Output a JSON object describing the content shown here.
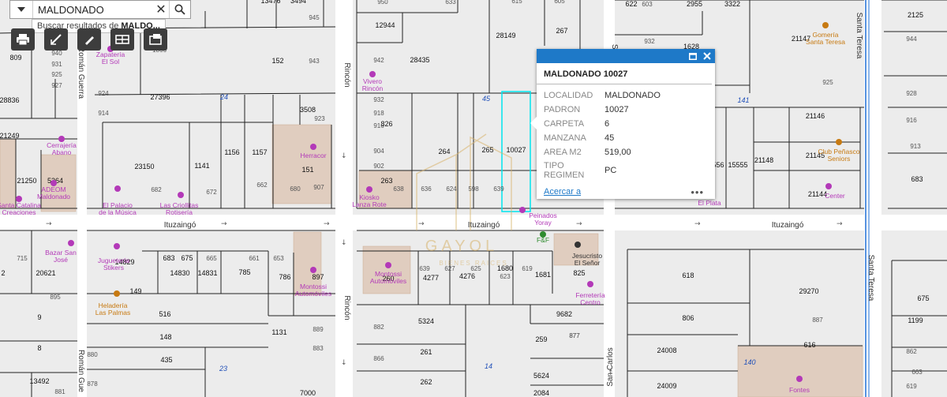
{
  "search": {
    "value": "MALDONADO",
    "suggestion_prefix": "Buscar resultados de ",
    "suggestion_term": "MALDO..."
  },
  "toolbar": {
    "icons": [
      "printer-icon",
      "measure-icon",
      "draw-icon",
      "table-icon",
      "layers-icon"
    ]
  },
  "popup": {
    "title": "MALDONADO 10027",
    "fields": [
      {
        "label": "LOCALIDAD",
        "value": "MALDONADO"
      },
      {
        "label": "PADRON",
        "value": "10027"
      },
      {
        "label": "CARPETA",
        "value": "6"
      },
      {
        "label": "MANZANA",
        "value": "45"
      },
      {
        "label": "AREA M2",
        "value": "519,00"
      },
      {
        "label": "TIPO REGIMEN",
        "value": "PC"
      }
    ],
    "zoom_link": "Acercar a",
    "more": "•••",
    "header_color": "#1e79c8"
  },
  "watermark": {
    "brand": "GAYOL",
    "tagline": "BIENES RAICES"
  },
  "streets": [
    {
      "name": "Ituzaingó"
    },
    {
      "name": "Ituzaingó"
    },
    {
      "name": "Ituzaingó"
    },
    {
      "name": "Ituzaingó"
    },
    {
      "name": "Rincón"
    },
    {
      "name": "Rincón"
    },
    {
      "name": "Román Guerra"
    },
    {
      "name": "Román Gue"
    },
    {
      "name": "Santa Teresa"
    },
    {
      "name": "Santa Teresa"
    },
    {
      "name": "San Carlos"
    },
    {
      "name": "Sa"
    }
  ],
  "block_numbers": [
    "24",
    "45",
    "141",
    "23",
    "14",
    "140"
  ],
  "parcels": [
    "809",
    "940",
    "931",
    "925",
    "927",
    "28836",
    "21249",
    "21250",
    "5364",
    "27396",
    "924",
    "914",
    "152",
    "943",
    "1866",
    "3494",
    "945",
    "13476",
    "1141",
    "1156",
    "1157",
    "3508",
    "923",
    "151",
    "662",
    "680",
    "907",
    "672",
    "23150",
    "682",
    "12944",
    "950",
    "633",
    "615",
    "605",
    "28149",
    "267",
    "28435",
    "942",
    "932",
    "918",
    "826",
    "916",
    "904",
    "902",
    "263",
    "638",
    "636",
    "624",
    "598",
    "639",
    "264",
    "265",
    "10027",
    "622",
    "603",
    "2955",
    "3322",
    "932",
    "1628",
    "21147",
    "925",
    "21146",
    "21145",
    "21144",
    "21148",
    "15555",
    "556",
    "2125",
    "944",
    "928",
    "916",
    "913",
    "683",
    "14829",
    "683",
    "675",
    "665",
    "661",
    "653",
    "14830",
    "14831",
    "785",
    "786",
    "897",
    "2",
    "20621",
    "895",
    "715",
    "9",
    "8",
    "13492",
    "881",
    "149",
    "516",
    "148",
    "435",
    "880",
    "878",
    "889",
    "883",
    "877",
    "1131",
    "260",
    "639",
    "4277",
    "627",
    "4276",
    "625",
    "623",
    "1680",
    "619",
    "1681",
    "825",
    "882",
    "5324",
    "9682",
    "261",
    "259",
    "877",
    "866",
    "262",
    "5624",
    "2084",
    "7000",
    "618",
    "806",
    "29270",
    "24008",
    "616",
    "24009",
    "887",
    "675",
    "1199",
    "862",
    "663",
    "619"
  ],
  "pois": [
    {
      "name": "Zapatería\nEl Sol",
      "color": "#b339b8"
    },
    {
      "name": "Cerrajería\nAbano",
      "color": "#b339b8"
    },
    {
      "name": "ADEOM\nMaldonado",
      "color": "#b339b8"
    },
    {
      "name": "Santa Catalina\nCreaciones",
      "color": "#b339b8"
    },
    {
      "name": "El Palacio\nde la Música",
      "color": "#b339b8"
    },
    {
      "name": "Las Criollitas\nRotisería",
      "color": "#b339b8"
    },
    {
      "name": "Herracor",
      "color": "#b339b8"
    },
    {
      "name": "Vivero\nRincón",
      "color": "#b339b8"
    },
    {
      "name": "Kiosko\nLanza Rote",
      "color": "#b339b8"
    },
    {
      "name": "Peinados\nYoray",
      "color": "#b339b8"
    },
    {
      "name": "F&F",
      "color": "#2e8b2e"
    },
    {
      "name": "Gomería\nSanta Teresa",
      "color": "#c77a12"
    },
    {
      "name": "Club Peñasco\nSeniors",
      "color": "#c77a12"
    },
    {
      "name": "Center",
      "color": "#b339b8"
    },
    {
      "name": "El Plata",
      "color": "#b339b8"
    },
    {
      "name": "Bazar San\nJosé",
      "color": "#b339b8"
    },
    {
      "name": "Juguetería\nStikers",
      "color": "#b339b8"
    },
    {
      "name": "Heladería\nLas Palmas",
      "color": "#c77a12"
    },
    {
      "name": "Montossi\nAutomóviles",
      "color": "#b339b8"
    },
    {
      "name": "Montossi\nAutomóviles",
      "color": "#b339b8"
    },
    {
      "name": "Jesucristo\nEl Señor",
      "color": "#333333"
    },
    {
      "name": "Ferretería\nCentro",
      "color": "#b339b8"
    },
    {
      "name": "Fontes",
      "color": "#b339b8"
    }
  ],
  "colors": {
    "background": "#ececec",
    "street": "#ffffff",
    "parcel_line": "#222222",
    "selected_parcel": "#00e5ee",
    "poi": "#b339b8",
    "building": "#dcc3b0",
    "river": "#1e6fd6"
  }
}
